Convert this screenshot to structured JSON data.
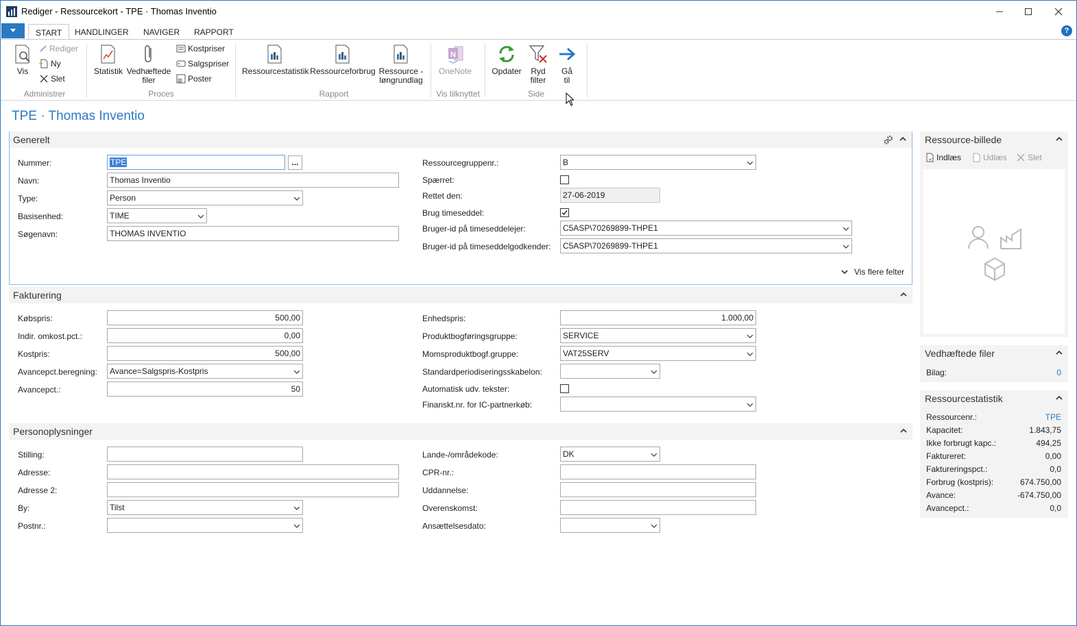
{
  "window": {
    "title": "Rediger - Ressourcekort - TPE · Thomas  Inventio"
  },
  "ribbon": {
    "tabs": [
      "START",
      "HANDLINGER",
      "NAVIGER",
      "RAPPORT"
    ],
    "groups": {
      "administrer": {
        "label": "Administrer",
        "vis": "Vis",
        "rediger": "Rediger",
        "ny": "Ny",
        "slet": "Slet"
      },
      "proces": {
        "label": "Proces",
        "statistik": "Statistik",
        "vedhaeftede_line1": "Vedhæftede",
        "vedhaeftede_line2": "filer",
        "kostpriser": "Kostpriser",
        "salgspriser": "Salgspriser",
        "poster": "Poster"
      },
      "rapport": {
        "label": "Rapport",
        "ressourcestatistik": "Ressourcestatistik",
        "ressourceforbrug": "Ressourceforbrug",
        "ressource_line1": "Ressource -",
        "ressource_line2": "løngrundlag"
      },
      "vis_tilknyttet": {
        "label": "Vis tilknyttet",
        "onenote": "OneNote"
      },
      "side": {
        "label": "Side",
        "opdater": "Opdater",
        "ryd_line1": "Ryd",
        "ryd_line2": "filter",
        "gaa_line1": "Gå",
        "gaa_line2": "til"
      }
    }
  },
  "page_title": "TPE · Thomas  Inventio",
  "generelt": {
    "title": "Generelt",
    "nummer_label": "Nummer:",
    "nummer_value": "TPE",
    "navn_label": "Navn:",
    "navn_value": "Thomas  Inventio",
    "type_label": "Type:",
    "type_value": "Person",
    "basisenhed_label": "Basisenhed:",
    "basisenhed_value": "TIME",
    "soegenavn_label": "Søgenavn:",
    "soegenavn_value": "THOMAS INVENTIO",
    "ressourcegruppe_label": "Ressourcegruppenr.:",
    "ressourcegruppe_value": "B",
    "spaerret_label": "Spærret:",
    "rettet_label": "Rettet den:",
    "rettet_value": "27-06-2019",
    "brug_timeseddel_label": "Brug timeseddel:",
    "bruger_timeseddelejer_label": "Bruger-id på timeseddelejer:",
    "bruger_timeseddelejer_value": "C5ASP\\70269899-THPE1",
    "bruger_godkender_label": "Bruger-id på timeseddelgodkender:",
    "bruger_godkender_value": "C5ASP\\70269899-THPE1",
    "vis_flere": "Vis flere felter",
    "ellipsis": "..."
  },
  "fakturering": {
    "title": "Fakturering",
    "koebspris_label": "Købspris:",
    "koebspris_value": "500,00",
    "indir_label": "Indir. omkost.pct.:",
    "indir_value": "0,00",
    "kostpris_label": "Kostpris:",
    "kostpris_value": "500,00",
    "avanceberegning_label": "Avancepct.beregning:",
    "avanceberegning_value": "Avance=Salgspris-Kostpris",
    "avancepct_label": "Avancepct.:",
    "avancepct_value": "50",
    "enhedspris_label": "Enhedspris:",
    "enhedspris_value": "1.000,00",
    "produktbogf_label": "Produktbogføringsgruppe:",
    "produktbogf_value": "SERVICE",
    "momsprod_label": "Momsproduktbogf.gruppe:",
    "momsprod_value": "VAT25SERV",
    "standardperiod_label": "Standardperiodiseringsskabelon:",
    "automatisk_label": "Automatisk udv. tekster:",
    "finanskt_label": "Finanskt.nr. for IC-partnerkøb:"
  },
  "personoplysninger": {
    "title": "Personoplysninger",
    "stilling_label": "Stilling:",
    "adresse_label": "Adresse:",
    "adresse2_label": "Adresse 2:",
    "by_label": "By:",
    "by_value": "Tilst",
    "postnr_label": "Postnr.:",
    "lande_label": "Lande-/områdekode:",
    "lande_value": "DK",
    "cpr_label": "CPR-nr.:",
    "uddannelse_label": "Uddannelse:",
    "overenskomst_label": "Overenskomst:",
    "ansaettelse_label": "Ansættelsesdato:"
  },
  "factbox": {
    "billede": {
      "title": "Ressource-billede",
      "indlaes": "Indlæs",
      "udlaes": "Udlæs",
      "slet": "Slet"
    },
    "vedhaeftede": {
      "title": "Vedhæftede filer",
      "bilag_label": "Bilag:",
      "bilag_value": "0"
    },
    "statistik": {
      "title": "Ressourcestatistik",
      "rows": [
        {
          "label": "Ressourcenr.:",
          "value": "TPE"
        },
        {
          "label": "Kapacitet:",
          "value": "1.843,75"
        },
        {
          "label": "Ikke forbrugt kapc.:",
          "value": "494,25"
        },
        {
          "label": "Faktureret:",
          "value": "0,00"
        },
        {
          "label": "Faktureringspct.:",
          "value": "0,0"
        },
        {
          "label": "Forbrug (kostpris):",
          "value": "674.750,00"
        },
        {
          "label": "Avance:",
          "value": "-674.750,00"
        },
        {
          "label": "Avancepct.:",
          "value": "0,0"
        }
      ]
    }
  }
}
